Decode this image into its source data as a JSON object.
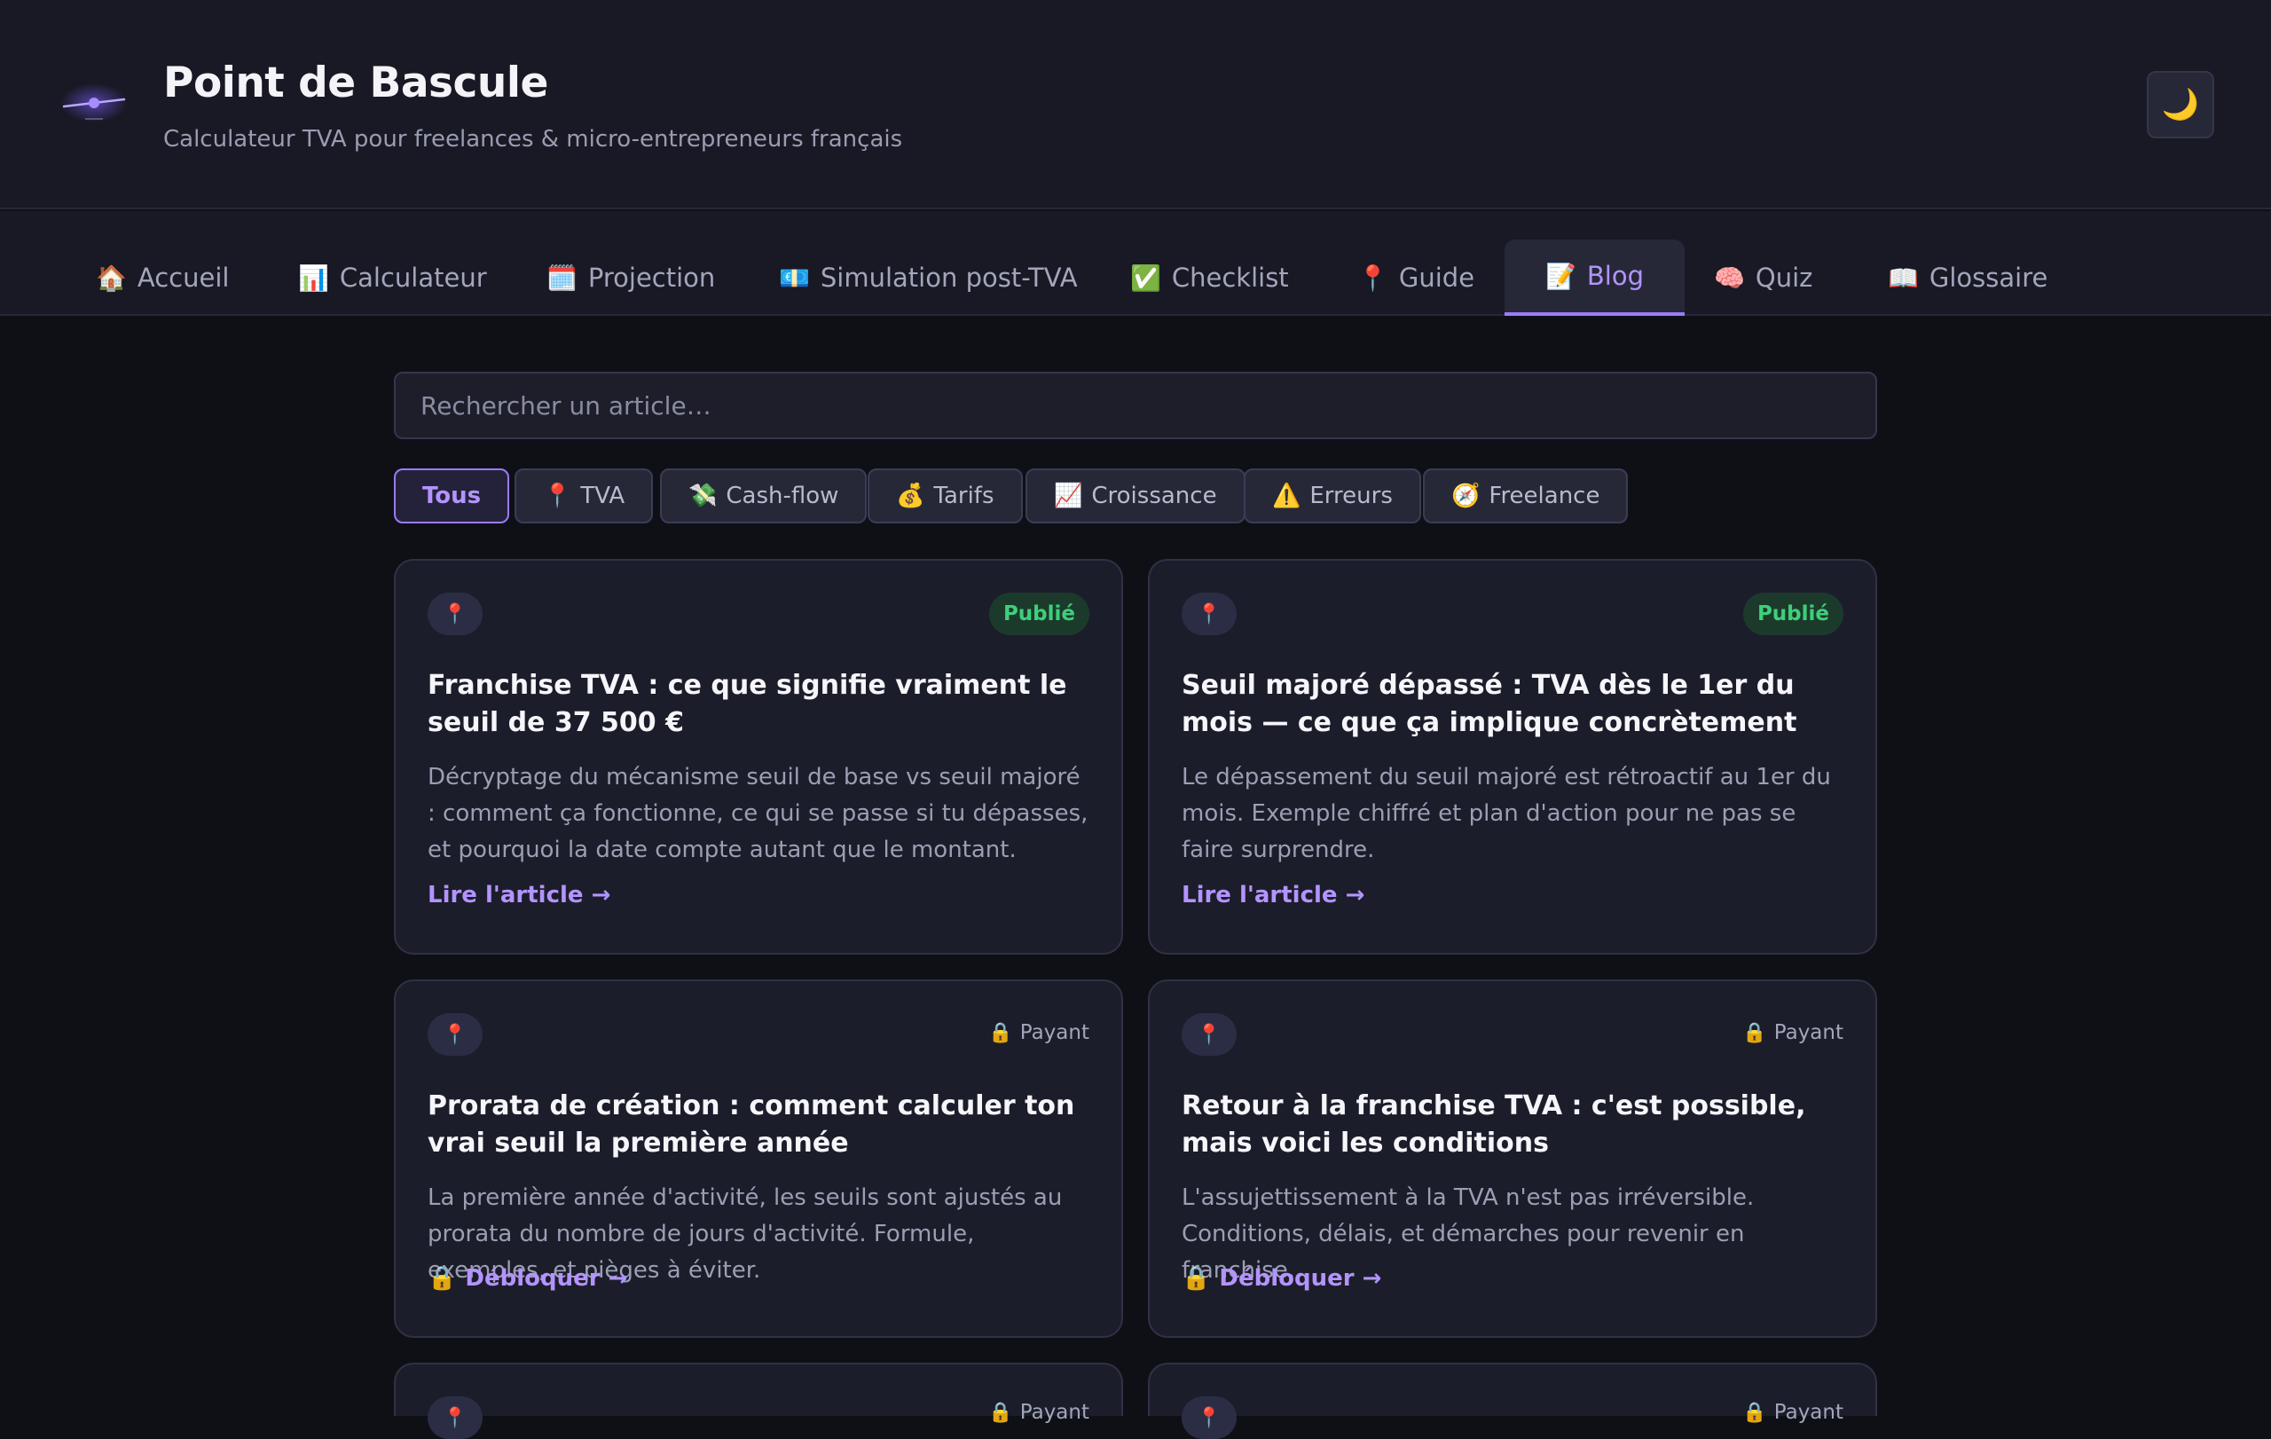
{
  "app": {
    "title": "Point de Bascule",
    "subtitle": "Calculateur TVA pour freelances & micro-entrepreneurs français",
    "theme_toggle_icon": "🌙"
  },
  "nav": {
    "tabs": [
      {
        "icon": "🏠",
        "label": "Accueil"
      },
      {
        "icon": "📊",
        "label": "Calculateur"
      },
      {
        "icon": "🗓️",
        "label": "Projection"
      },
      {
        "icon": "💶",
        "label": "Simulation post-TVA"
      },
      {
        "icon": "✅",
        "label": "Checklist"
      },
      {
        "icon": "📍",
        "label": "Guide"
      },
      {
        "icon": "📝",
        "label": "Blog"
      },
      {
        "icon": "🧠",
        "label": "Quiz"
      },
      {
        "icon": "📖",
        "label": "Glossaire"
      }
    ],
    "active": "Blog"
  },
  "search": {
    "placeholder": "Rechercher un article…",
    "value": ""
  },
  "filters": [
    {
      "icon": "",
      "label": "Tous"
    },
    {
      "icon": "📍",
      "label": "TVA"
    },
    {
      "icon": "💸",
      "label": "Cash-flow"
    },
    {
      "icon": "💰",
      "label": "Tarifs"
    },
    {
      "icon": "📈",
      "label": "Croissance"
    },
    {
      "icon": "⚠️",
      "label": "Erreurs"
    },
    {
      "icon": "🧭",
      "label": "Freelance"
    }
  ],
  "articles": [
    {
      "icon": "📍",
      "status": "Publié",
      "title": "Franchise TVA : ce que signifie vraiment le seuil de 37 500 €",
      "description": "Décryptage du mécanisme seuil de base vs seuil majoré : comment ça fonctionne, ce qui se passe si tu dépasses, et pourquoi la date compte autant que le montant.",
      "link": "Lire l'article →"
    },
    {
      "icon": "📍",
      "status": "Publié",
      "title": "Seuil majoré dépassé : TVA dès le 1er du mois — ce que ça implique concrètement",
      "description": "Le dépassement du seuil majoré est rétroactif au 1er du mois. Exemple chiffré et plan d'action pour ne pas se faire surprendre.",
      "link": "Lire l'article →"
    },
    {
      "icon": "📍",
      "status": "Payant",
      "title": "Prorata de création : comment calculer ton vrai seuil la première année",
      "description": "La première année d'activité, les seuils sont ajustés au prorata du nombre de jours d'activité. Formule, exemples, et pièges à éviter.",
      "link": "Débloquer →"
    },
    {
      "icon": "📍",
      "status": "Payant",
      "title": "Retour à la franchise TVA : c'est possible, mais voici les conditions",
      "description": "L'assujettissement à la TVA n'est pas irréversible. Conditions, délais, et démarches pour revenir en franchise.",
      "link": "Débloquer →"
    },
    {
      "icon": "📍",
      "status": "Payant"
    },
    {
      "icon": "📍",
      "status": "Payant"
    }
  ],
  "lock_icon": "🔒",
  "colors": {
    "accent": "#9b7bff",
    "published": "#3ecf7a",
    "background": "#0f1016",
    "card": "#1c1d2a"
  }
}
